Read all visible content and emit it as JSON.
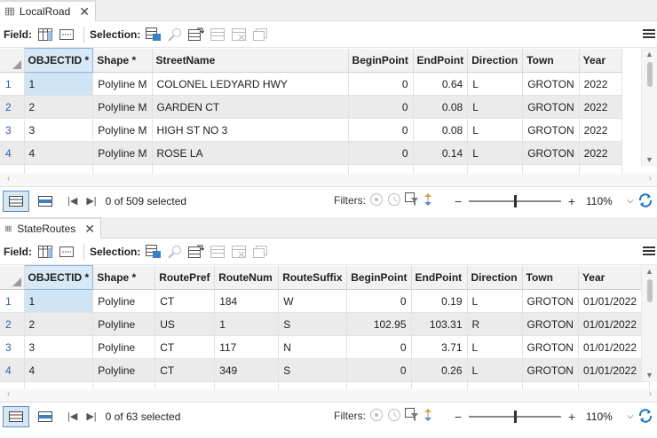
{
  "tables": [
    {
      "tab_label": "LocalRoad",
      "field_label": "Field:",
      "selection_label": "Selection:",
      "columns": [
        "OBJECTID *",
        "Shape *",
        "StreetName",
        "BeginPoint",
        "EndPoint",
        "Direction",
        "Town",
        "Year"
      ],
      "rows": [
        [
          "1",
          "1",
          "Polyline M",
          "COLONEL LEDYARD HWY",
          "0",
          "0.64",
          "L",
          "GROTON",
          "2022"
        ],
        [
          "2",
          "2",
          "Polyline M",
          "GARDEN CT",
          "0",
          "0.08",
          "L",
          "GROTON",
          "2022"
        ],
        [
          "3",
          "3",
          "Polyline M",
          "HIGH ST NO 3",
          "0",
          "0.08",
          "L",
          "GROTON",
          "2022"
        ],
        [
          "4",
          "4",
          "Polyline M",
          "ROSE LA",
          "0",
          "0.14",
          "L",
          "GROTON",
          "2022"
        ]
      ],
      "selection_status": "0 of 509 selected",
      "filters_label": "Filters:",
      "zoom": "110%",
      "zoom_level_fraction": 0.5
    },
    {
      "tab_label": "StateRoutes",
      "field_label": "Field:",
      "selection_label": "Selection:",
      "columns": [
        "OBJECTID *",
        "Shape *",
        "RoutePref",
        "RouteNum",
        "RouteSuffix",
        "BeginPoint",
        "EndPoint",
        "Direction",
        "Town",
        "Year"
      ],
      "rows": [
        [
          "1",
          "1",
          "Polyline",
          "CT",
          "184",
          "W",
          "0",
          "0.19",
          "L",
          "GROTON",
          "01/01/2022"
        ],
        [
          "2",
          "2",
          "Polyline",
          "US",
          "1",
          "S",
          "102.95",
          "103.31",
          "R",
          "GROTON",
          "01/01/2022"
        ],
        [
          "3",
          "3",
          "Polyline",
          "CT",
          "117",
          "N",
          "0",
          "3.71",
          "L",
          "GROTON",
          "01/01/2022"
        ],
        [
          "4",
          "4",
          "Polyline",
          "CT",
          "349",
          "S",
          "0",
          "0.26",
          "L",
          "GROTON",
          "01/01/2022"
        ]
      ],
      "selection_status": "0 of 63 selected",
      "filters_label": "Filters:",
      "zoom": "110%",
      "zoom_level_fraction": 0.5
    }
  ],
  "icons": {
    "table": "table-icon",
    "close": "close-icon",
    "add_field": "add-field-icon",
    "calculate_field": "calculate-field-icon",
    "select_by_attributes": "select-by-attributes-icon",
    "zoom_to_selection": "zoom-to-selection-icon",
    "switch_selection": "switch-selection-icon",
    "clear_selection": "clear-selection-icon",
    "delete_selection": "delete-selection-icon",
    "copy_selection": "copy-selection-icon",
    "menu": "menu-icon",
    "refresh": "refresh-icon"
  },
  "colors": {
    "selected_column_header": "#d7e8f6",
    "selected_cell": "#cfe4f5",
    "alt_row": "#ebebeb",
    "accent": "#1a73c8"
  }
}
